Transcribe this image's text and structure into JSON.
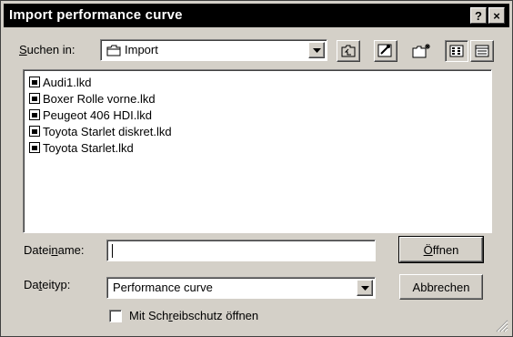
{
  "window": {
    "title": "Import performance curve",
    "help_glyph": "?",
    "close_glyph": "×"
  },
  "lookin": {
    "label": "Suchen in:",
    "value": "Import"
  },
  "files": [
    {
      "name": "Audi1.lkd"
    },
    {
      "name": "Boxer Rolle vorne.lkd"
    },
    {
      "name": "Peugeot 406 HDI.lkd"
    },
    {
      "name": "Toyota Starlet diskret.lkd"
    },
    {
      "name": "Toyota Starlet.lkd"
    }
  ],
  "filename": {
    "label": "Dateiname:",
    "value": ""
  },
  "filetype": {
    "label": "Dateityp:",
    "value": "Performance curve"
  },
  "buttons": {
    "open": "Öffnen",
    "cancel": "Abbrechen"
  },
  "readonly": {
    "label": "Mit Schreibschutz öffnen",
    "checked": false
  },
  "icons": [
    "up-folder-icon",
    "desktop-icon",
    "new-folder-icon",
    "list-view-icon",
    "details-view-icon"
  ]
}
